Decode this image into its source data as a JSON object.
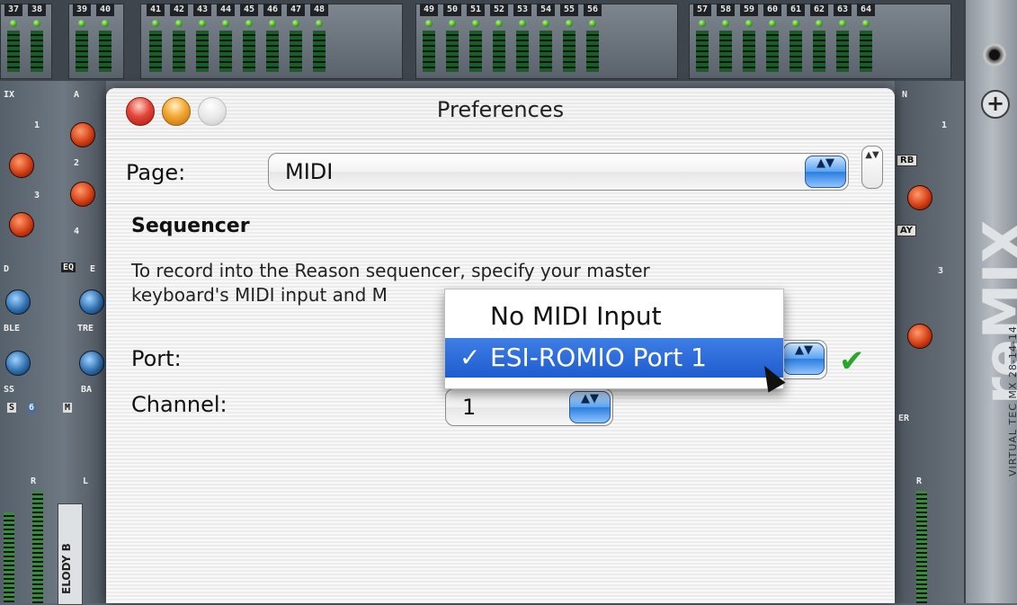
{
  "mixer": {
    "channel_numbers": [
      "37",
      "38",
      "39",
      "40",
      "41",
      "42",
      "43",
      "44",
      "45",
      "46",
      "47",
      "48",
      "49",
      "50",
      "51",
      "52",
      "53",
      "54",
      "55",
      "56",
      "57",
      "58",
      "59",
      "60",
      "61",
      "62",
      "63",
      "64"
    ],
    "left_labels": {
      "aux": "IX",
      "aux2": "A",
      "k1": "1",
      "k2": "2",
      "k3": "3",
      "k4": "4",
      "eq": "D",
      "eq_btn": "EQ",
      "eq2": "E",
      "treble": "BLE",
      "treble2": "TRE",
      "bass": "SS",
      "bass2": "BA",
      "s": "S",
      "six": "6",
      "m": "M",
      "r": "R",
      "l": "L"
    },
    "melody_label": "ELODY B",
    "right_labels": {
      "n": "N",
      "one": "1",
      "rb": "RB",
      "ay": "AY",
      "three": "3",
      "er": "ER",
      "r": "R"
    },
    "plus_label": "+",
    "logo": "reMIX",
    "side_text": "VIRTUAL TEC MX 28-14-14"
  },
  "preferences": {
    "title": "Preferences",
    "page_label": "Page:",
    "page_value": "MIDI",
    "section_title": "Sequencer",
    "description_line1": "To record into the Reason sequencer, specify your master",
    "description_line2": "keyboard's MIDI input and M",
    "port_label": "Port:",
    "channel_label": "Channel:",
    "channel_value": "1",
    "status_check": "✔"
  },
  "port_menu": {
    "items": [
      {
        "label": "No MIDI Input",
        "selected": false
      },
      {
        "label": "ESI-ROMIO Port 1",
        "selected": true
      }
    ],
    "checkmark": "✓"
  },
  "icons": {
    "close": "close-icon",
    "minimize": "minimize-icon",
    "zoom": "zoom-icon",
    "popup_arrows": "▲▼",
    "stepper_arrows": "▲▼"
  }
}
